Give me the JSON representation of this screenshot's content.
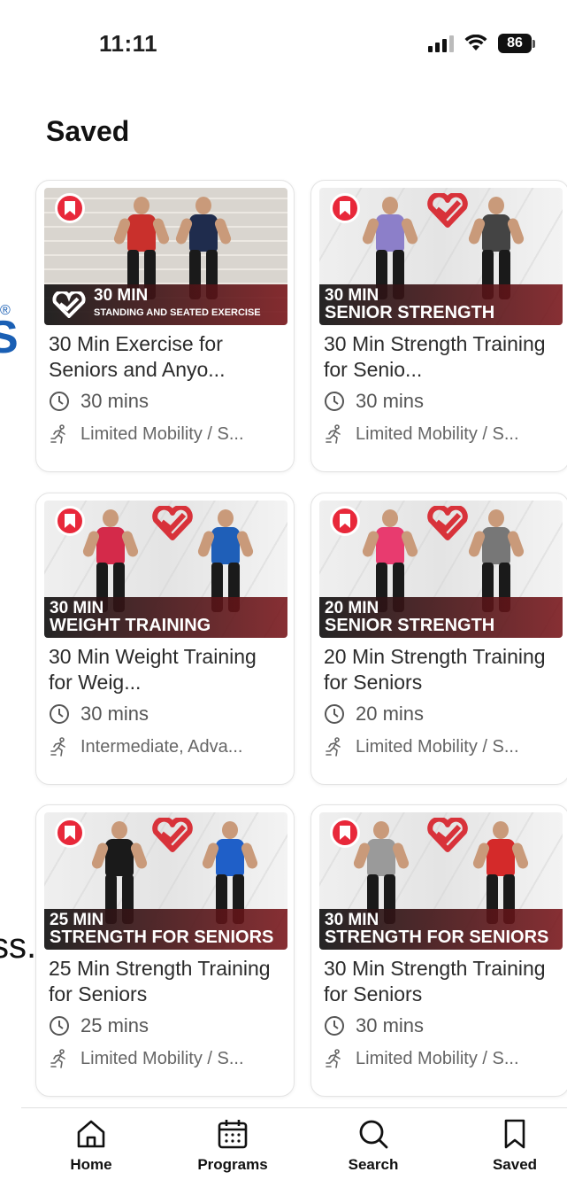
{
  "status_bar": {
    "time": "11:11",
    "battery": "86"
  },
  "page_title": "Saved",
  "side_fragments": {
    "registered": "®",
    "glyph": "S",
    "text": "ss."
  },
  "cards": [
    {
      "thumb_line1": "30 MIN",
      "thumb_line2": "STANDING AND SEATED EXERCISE",
      "title": "30 Min Exercise for Seniors and Anyo...",
      "duration": "30 mins",
      "level": "Limited Mobility / S..."
    },
    {
      "thumb_line1": "30 MIN",
      "thumb_line2": "SENIOR STRENGTH",
      "title": "30 Min Strength Training for Senio...",
      "duration": "30 mins",
      "level": "Limited Mobility / S..."
    },
    {
      "thumb_line1": "30 MIN",
      "thumb_line2": "WEIGHT TRAINING",
      "title": "30 Min Weight Training for Weig...",
      "duration": "30 mins",
      "level": "Intermediate,  Adva..."
    },
    {
      "thumb_line1": "20 MIN",
      "thumb_line2": "SENIOR STRENGTH",
      "title": "20 Min Strength Training for Seniors",
      "duration": "20 mins",
      "level": "Limited Mobility / S..."
    },
    {
      "thumb_line1": "25 MIN",
      "thumb_line2": "STRENGTH FOR SENIORS",
      "title": "25 Min Strength Training for Seniors",
      "duration": "25 mins",
      "level": "Limited Mobility / S..."
    },
    {
      "thumb_line1": "30 MIN",
      "thumb_line2": "STRENGTH FOR SENIORS",
      "title": "30 Min Strength Training for Seniors",
      "duration": "30 mins",
      "level": "Limited Mobility / S..."
    }
  ],
  "tab_bar": {
    "home": "Home",
    "programs": "Programs",
    "search": "Search",
    "saved": "Saved"
  },
  "icons": {
    "bookmark_badge": "bookmark-icon",
    "duration": "clock-icon",
    "level": "running-figure-icon",
    "tabs": [
      "home-icon",
      "calendar-icon",
      "search-icon",
      "bookmark-icon"
    ]
  },
  "colors": {
    "accent_red": "#e8283a",
    "brand_blue": "#1a5fb4"
  }
}
